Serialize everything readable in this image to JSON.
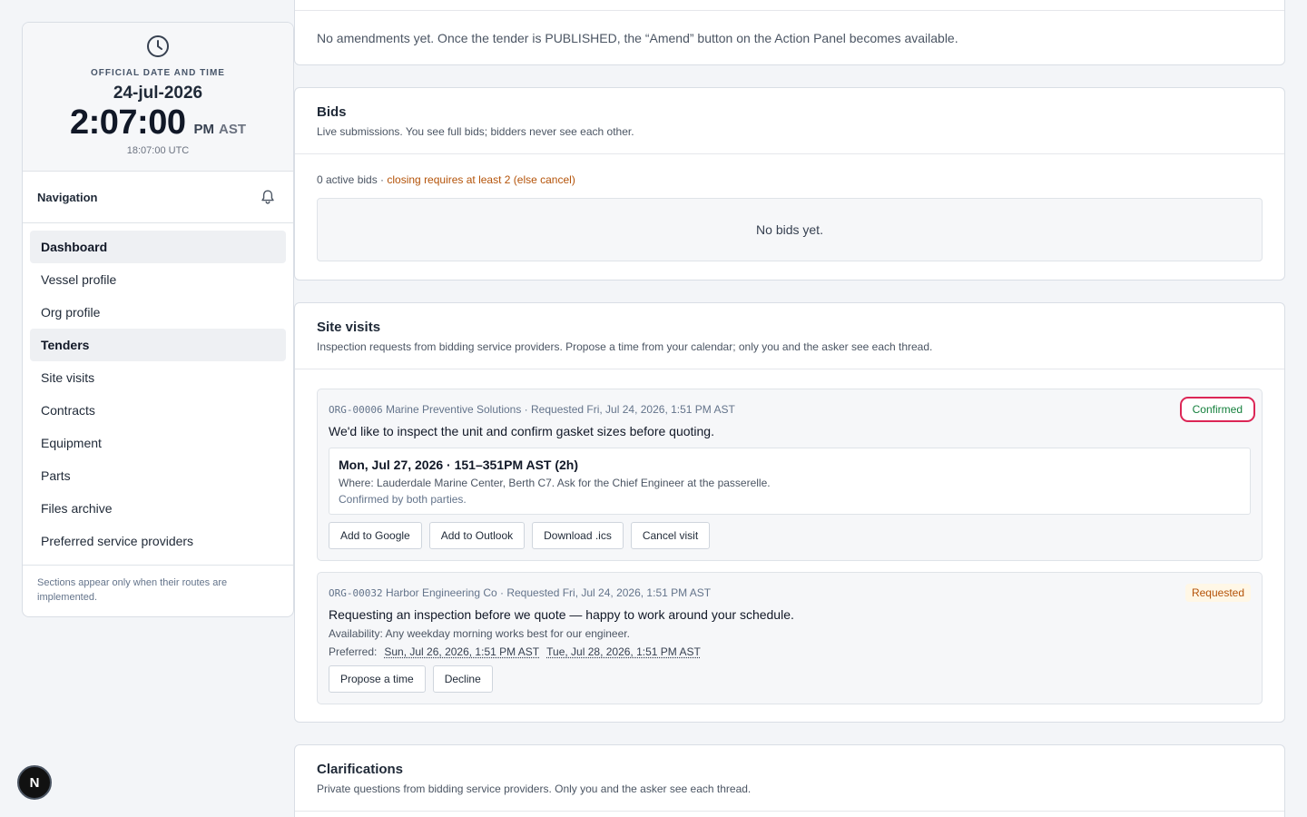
{
  "clock": {
    "caption": "OFFICIAL DATE AND TIME",
    "date": "24-jul-2026",
    "time": "2:07:00",
    "ampm": "PM",
    "tz": "AST",
    "utc": "18:07:00 UTC"
  },
  "nav": {
    "title": "Navigation",
    "items": [
      {
        "label": "Dashboard"
      },
      {
        "label": "Vessel profile"
      },
      {
        "label": "Org profile"
      },
      {
        "label": "Tenders"
      },
      {
        "label": "Site visits"
      },
      {
        "label": "Contracts"
      },
      {
        "label": "Equipment"
      },
      {
        "label": "Parts"
      },
      {
        "label": "Files archive"
      },
      {
        "label": "Preferred service providers"
      }
    ],
    "note": "Sections appear only when their routes are implemented."
  },
  "amendments": {
    "text": "No amendments yet. Once the tender is PUBLISHED, the “Amend” button on the Action Panel becomes available."
  },
  "bids": {
    "title": "Bids",
    "subtitle": "Live submissions. You see full bids; bidders never see each other.",
    "meta_count": "0 active bids · ",
    "meta_warn": "closing requires at least 2 (else cancel)",
    "empty": "No bids yet."
  },
  "site_visits": {
    "title": "Site visits",
    "subtitle": "Inspection requests from bidding service providers. Propose a time from your calendar; only you and the asker see each thread.",
    "visits": [
      {
        "org_id": "ORG-00006",
        "meta": " Marine Preventive Solutions · Requested Fri, Jul 24, 2026, 1:51 PM AST",
        "status": "Confirmed",
        "message": "We'd like to inspect the unit and confirm gasket sizes before quoting.",
        "slot_title": "Mon, Jul 27, 2026 · 151–351PM AST (2h)",
        "slot_where": "Where: Lauderdale Marine Center, Berth C7. Ask for the Chief Engineer at the passerelle.",
        "slot_confirmed": "Confirmed by both parties.",
        "buttons": [
          "Add to Google",
          "Add to Outlook",
          "Download .ics",
          "Cancel visit"
        ]
      },
      {
        "org_id": "ORG-00032",
        "meta": " Harbor Engineering Co · Requested Fri, Jul 24, 2026, 1:51 PM AST",
        "status": "Requested",
        "message": "Requesting an inspection before we quote — happy to work around your schedule.",
        "availability": "Availability: Any weekday morning works best for our engineer.",
        "preferred_label": "Preferred:",
        "preferred": [
          "Sun, Jul 26, 2026, 1:51 PM AST",
          "Tue, Jul 28, 2026, 1:51 PM AST"
        ],
        "buttons": [
          "Propose a time",
          "Decline"
        ]
      }
    ]
  },
  "clarifications": {
    "title": "Clarifications",
    "subtitle": "Private questions from bidding service providers. Only you and the asker see each thread."
  },
  "fab": {
    "label": "N"
  },
  "colors": {
    "background": "#f3f5f8",
    "warning": "#b45309",
    "confirmed": "#15803d",
    "highlight_ring": "#dc2656"
  }
}
